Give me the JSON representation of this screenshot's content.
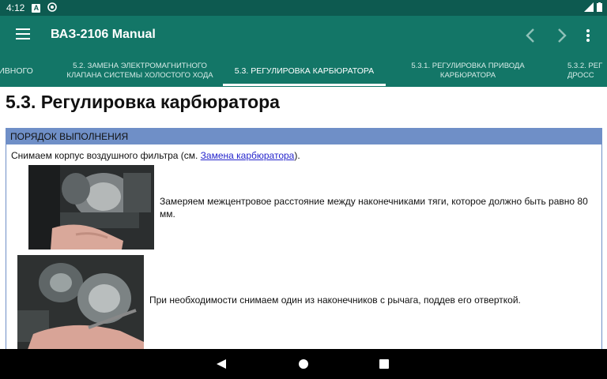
{
  "status": {
    "time": "4:12"
  },
  "appbar": {
    "title": "ВАЗ-2106 Manual"
  },
  "tabs": [
    {
      "label": "ИВНОГО"
    },
    {
      "label": "5.2. ЗАМЕНА ЭЛЕКТРОМАГНИТНОГО\nКЛАПАНА СИСТЕМЫ ХОЛОСТОГО ХОДА"
    },
    {
      "label": "5.3. РЕГУЛИРОВКА КАРБЮРАТОРА"
    },
    {
      "label": "5.3.1. РЕГУЛИРОВКА ПРИВОДА\nКАРБЮРАТОРА"
    },
    {
      "label": "5.3.2. РЕГ\nДРОСС"
    }
  ],
  "page": {
    "title": "5.3. Регулировка карбюратора",
    "section_header": "ПОРЯДОК ВЫПОЛНЕНИЯ",
    "intro_prefix": "Снимаем корпус воздушного фильтра (см. ",
    "intro_link": "Замена карбюратора",
    "intro_suffix": ").",
    "steps": [
      {
        "text": "Замеряем межцентровое расстояние между наконечниками тяги, которое должно быть равно 80 мм."
      },
      {
        "text": "При необходимости снимаем один из наконечников с рычага, поддев его отверткой."
      }
    ]
  },
  "colors": {
    "appbar": "#137667",
    "statusbar": "#0d5a50",
    "box_border": "#6f8fc7",
    "link": "#2525cc"
  },
  "icons": [
    "menu-icon",
    "chevron-left-icon",
    "chevron-right-icon",
    "more-vert-icon",
    "back-triangle-icon",
    "home-circle-icon",
    "recents-square-icon"
  ]
}
